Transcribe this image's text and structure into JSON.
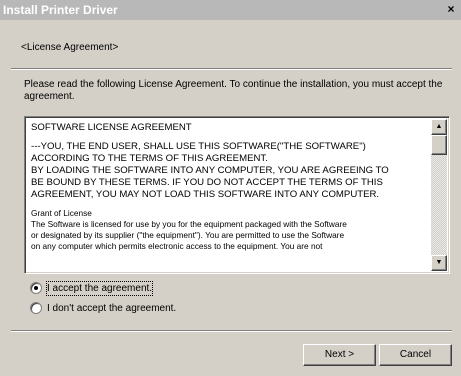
{
  "window": {
    "title": "Install Printer Driver",
    "close_glyph": "×"
  },
  "header": {
    "label": "<License Agreement>"
  },
  "intro": {
    "text": "Please read the following License Agreement. To continue the installation, you must accept the agreement."
  },
  "license": {
    "heading": "SOFTWARE LICENSE AGREEMENT",
    "para1": [
      "---YOU, THE END USER, SHALL USE THIS SOFTWARE(\"THE SOFTWARE\")",
      "ACCORDING TO THE TERMS OF THIS AGREEMENT.",
      "BY LOADING THE SOFTWARE INTO ANY COMPUTER, YOU ARE AGREEING TO",
      "BE BOUND BY THESE TERMS. IF YOU DO NOT ACCEPT THE TERMS OF THIS",
      "AGREEMENT, YOU MAY NOT LOAD THIS SOFTWARE INTO ANY COMPUTER."
    ],
    "grant_heading": "Grant of License",
    "grant_lines": [
      "The Software is licensed for use by you for the equipment packaged with the Software",
      "or designated by its supplier (\"the equipment\"). You are permitted to use the Software",
      "on any computer which permits electronic access to the equipment. You are not"
    ],
    "scroll_up_icon": "▲",
    "scroll_down_icon": "▼"
  },
  "options": {
    "accept_label": "I accept the agreement.",
    "decline_label": "I don't accept the agreement.",
    "selected": "accept"
  },
  "buttons": {
    "next_label": "Next >",
    "cancel_label": "Cancel"
  }
}
